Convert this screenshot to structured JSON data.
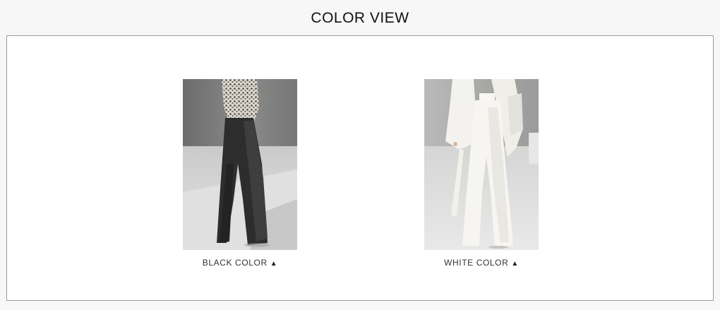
{
  "section": {
    "title": "COLOR VIEW"
  },
  "colors": [
    {
      "label": "BLACK COLOR",
      "arrow_icon": "triangle-up-icon",
      "image": "black-wide-pants-photo",
      "swatch_hex": "#2f2f2f"
    },
    {
      "label": "WHITE COLOR",
      "arrow_icon": "triangle-up-icon",
      "image": "white-wide-pants-photo",
      "swatch_hex": "#f4f2ee"
    }
  ],
  "arrow_glyph": "▲"
}
